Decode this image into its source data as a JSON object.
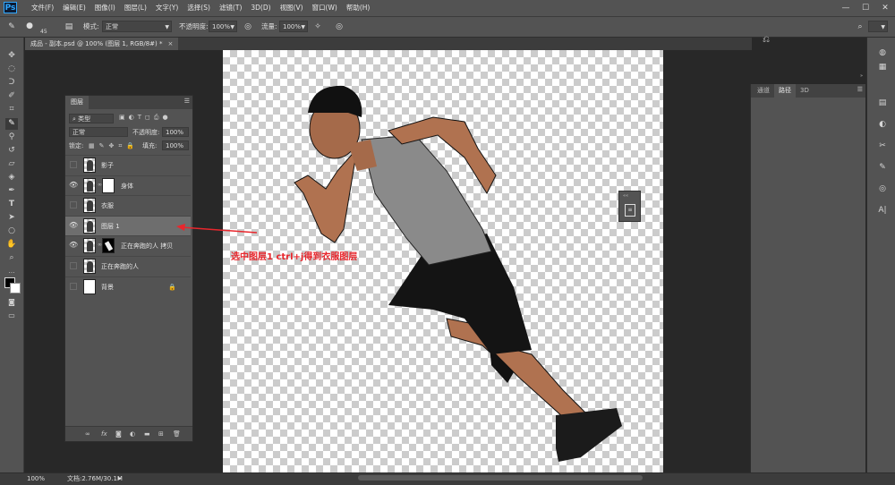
{
  "app": {
    "logo": "Ps"
  },
  "menu": [
    "文件(F)",
    "编辑(E)",
    "图像(I)",
    "图层(L)",
    "文字(Y)",
    "选择(S)",
    "滤镜(T)",
    "3D(D)",
    "视图(V)",
    "窗口(W)",
    "帮助(H)"
  ],
  "window_controls": {
    "minimize": "—",
    "maximize": "☐",
    "close": "✕"
  },
  "options_bar": {
    "brush_size": "45",
    "mode_label": "模式:",
    "mode_value": "正常",
    "opacity_label": "不透明度:",
    "opacity_value": "100%",
    "flow_label": "流量:",
    "flow_value": "100%"
  },
  "document_tab": {
    "title": "成品 - 副本.psd @ 100% (图层 1, RGB/8#) *",
    "close": "×"
  },
  "layers_panel": {
    "tab": "图层",
    "filter_label": "类型",
    "blend_mode": "正常",
    "opacity_label": "不透明度:",
    "opacity_value": "100%",
    "lock_label": "锁定:",
    "fill_label": "填充:",
    "fill_value": "100%",
    "layers": [
      {
        "name": "影子",
        "visible": false,
        "selected": false
      },
      {
        "name": "身体",
        "visible": true,
        "selected": false
      },
      {
        "name": "衣服",
        "visible": false,
        "selected": false
      },
      {
        "name": "图层 1",
        "visible": true,
        "selected": true
      },
      {
        "name": "正在奔跑的人 拷贝",
        "visible": true,
        "selected": false
      },
      {
        "name": "正在奔跑的人",
        "visible": false,
        "selected": false
      },
      {
        "name": "背景",
        "visible": false,
        "selected": false,
        "locked": true
      }
    ],
    "footer_icons": [
      "link-icon",
      "fx-icon",
      "mask-icon",
      "adjustment-icon",
      "folder-icon",
      "new-layer-icon",
      "trash-icon"
    ],
    "fx_text": "fx"
  },
  "right_panel": {
    "tabs": [
      "通道",
      "路径",
      "3D"
    ],
    "active_tab": "路径"
  },
  "annotation": {
    "text": "选中图层1 ctrl+j得到衣服图层",
    "color": "#e8272d"
  },
  "status_bar": {
    "zoom": "100%",
    "doc_info": "文档:2.76M/30.1M"
  }
}
